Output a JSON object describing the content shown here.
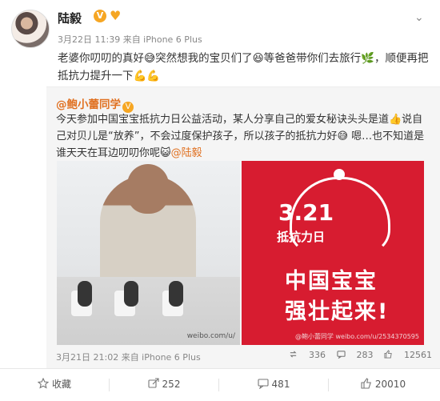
{
  "post": {
    "author": "陆毅",
    "meta": "3月22日 11:39 来自 iPhone 6 Plus",
    "text": "老婆你叨叨的真好😅突然想我的宝贝们了😆等爸爸带你们去旅行🌿，顺便再把抵抗力提升一下💪💪"
  },
  "repost": {
    "author": "@鲍小蕾同学",
    "text": "今天参加中国宝宝抵抗力日公益活动，某人分享自己的爱女秘诀头头是道👍说自己对贝儿是“放养”，不会过度保护孩子，所以孩子的抵抗力好😅 嗯…也不知道是谁天天在耳边叨叨你呢😺",
    "mention": "@陆毅",
    "image_left_watermark": "weibo.com/u/",
    "image_right": {
      "date": "3.21",
      "day_name": "抵抗力日",
      "line1": "中国宝宝",
      "line2": "强壮起来!",
      "watermark": "@鲍小蕾同学 weibo.com/u/2534370595"
    },
    "meta": "3月21日 21:02 来自 iPhone 6 Plus",
    "stats": {
      "reposts": "336",
      "comments": "283",
      "likes": "12561"
    }
  },
  "toolbar": {
    "collect": "收藏",
    "repost": "252",
    "comment": "481",
    "like": "20010"
  },
  "colors": {
    "accent": "#e07020",
    "brand_red": "#d71c30",
    "badge": "#f6a623"
  }
}
